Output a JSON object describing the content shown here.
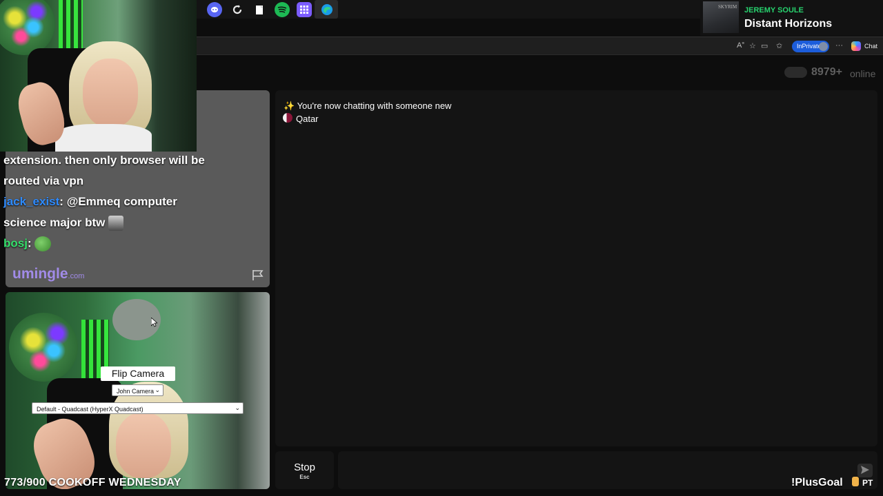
{
  "taskbar": {
    "icons": [
      {
        "name": "discord-icon",
        "color": "#5865f2"
      },
      {
        "name": "refresh-app-icon",
        "color": "#e8e8e8"
      },
      {
        "name": "notepad-icon",
        "color": "#ffffff"
      },
      {
        "name": "spotify-icon",
        "color": "#1db954"
      },
      {
        "name": "apps-grid-icon",
        "color": "#7b5cff"
      },
      {
        "name": "edge-icon",
        "color": "#1a9be8"
      }
    ]
  },
  "now_playing": {
    "art_label": "SKYRIM",
    "artist": "JEREMY SOULE",
    "title": "Distant Horizons"
  },
  "browser": {
    "inprivate_label": "InPrivate",
    "chat_label": "Chat"
  },
  "site": {
    "online_count": "8979+",
    "online_word": "online",
    "brand": "umingle",
    "brand_suffix": ".com"
  },
  "stream_chat": [
    {
      "user": "",
      "user_color": "#ffffff",
      "text": "extension. then only browser will be"
    },
    {
      "user": "",
      "user_color": "#ffffff",
      "text": "routed via vpn"
    },
    {
      "user": "jack_exist",
      "user_color": "#2e8bff",
      "text": "@Emmeq computer"
    },
    {
      "user": "",
      "user_color": "#ffffff",
      "text": "science major btw"
    },
    {
      "user": "bosj",
      "user_color": "#35e06b",
      "text": ""
    }
  ],
  "self_cam": {
    "flip_label": "Flip Camera",
    "camera_selected": "John Camera",
    "mic_selected": "Default - Quadcast (HyperX Quadcast)"
  },
  "messages": {
    "intro": "You're now chatting with someone new",
    "sparkle": "✨",
    "country": "Qatar"
  },
  "controls": {
    "stop_label": "Stop",
    "stop_hint": "Esc",
    "send_icon": "send-icon"
  },
  "overlay": {
    "goal_text": "773/900 COOKOFF WEDNESDAY",
    "plusgoal_text": "!PlusGoal",
    "plusgoal_badge": "PT"
  },
  "colors": {
    "accent_brand": "#a18be8",
    "inprivate_blue": "#1c5ddb",
    "spotify_green": "#27d36e"
  }
}
